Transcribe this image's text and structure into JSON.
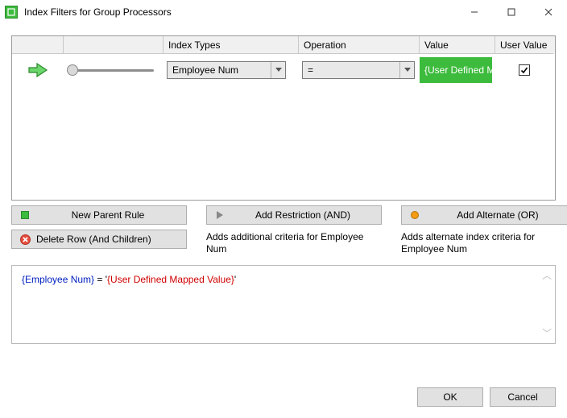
{
  "window": {
    "title": "Index Filters for Group Processors"
  },
  "grid": {
    "headers": {
      "index_types": "Index Types",
      "operation": "Operation",
      "value": "Value",
      "user_value": "User Value"
    },
    "row": {
      "index_type": "Employee Num",
      "operation": "=",
      "value": "{User Defined Ma...",
      "user_value_checked": true
    }
  },
  "actions": {
    "new_parent": {
      "label": "New Parent Rule"
    },
    "delete_row": {
      "label": "Delete Row (And Children)"
    },
    "add_and": {
      "label": "Add Restriction (AND)",
      "desc": "Adds additional criteria for Employee Num"
    },
    "add_or": {
      "label": "Add Alternate (OR)",
      "desc": "Adds alternate index criteria for Employee Num"
    }
  },
  "expression": {
    "field": "{Employee Num}",
    "eq": " = ",
    "q1": "'",
    "value": "{User Defined Mapped Value}",
    "q2": "'"
  },
  "buttons": {
    "ok": "OK",
    "cancel": "Cancel"
  }
}
